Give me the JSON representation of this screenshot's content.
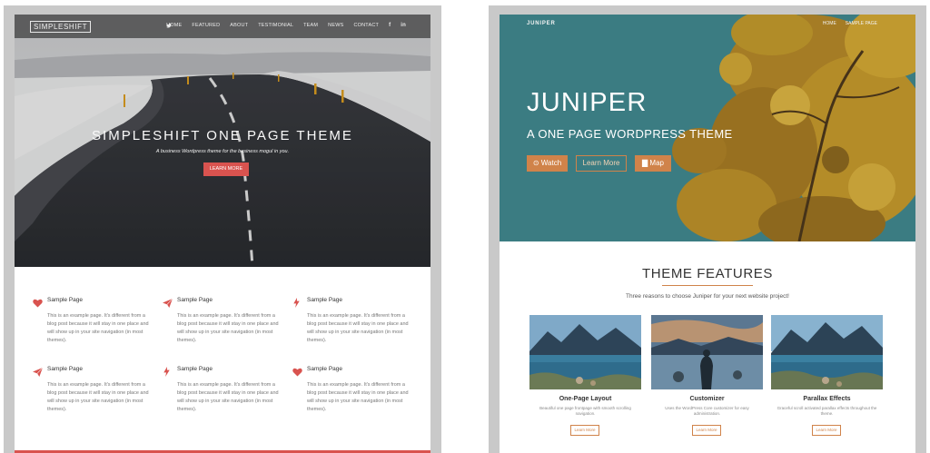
{
  "simpleshift": {
    "logo": "SIMPLESHIFT",
    "nav": [
      "HOME",
      "FEATURED",
      "ABOUT",
      "TESTIMONIAL",
      "TEAM",
      "NEWS",
      "CONTACT"
    ],
    "social": [
      "f",
      "in",
      "t"
    ],
    "hero_title": "SIMPLESHIFT ONE PAGE THEME",
    "hero_subtitle": "A business Wordpress theme for the business mogul in you.",
    "cta_label": "LEARN MORE",
    "features": [
      {
        "icon": "heart-icon",
        "title": "Sample Page",
        "text": "This is an example page. It's different from a blog post because it will stay in one place and will show up in your site navigation (in most themes)."
      },
      {
        "icon": "paper-plane-icon",
        "title": "Sample Page",
        "text": "This is an example page. It's different from a blog post because it will stay in one place and will show up in your site navigation (in most themes)."
      },
      {
        "icon": "lightning-icon",
        "title": "Sample Page",
        "text": "This is an example page. It's different from a blog post because it will stay in one place and will show up in your site navigation (in most themes)."
      },
      {
        "icon": "paper-plane-icon",
        "title": "Sample Page",
        "text": "This is an example page. It's different from a blog post because it will stay in one place and will show up in your site navigation (in most themes)."
      },
      {
        "icon": "lightning-icon",
        "title": "Sample Page",
        "text": "This is an example page. It's different from a blog post because it will stay in one place and will show up in your site navigation (in most themes)."
      },
      {
        "icon": "heart-icon",
        "title": "Sample Page",
        "text": "This is an example page. It's different from a blog post because it will stay in one place and will show up in your site navigation (in most themes)."
      }
    ],
    "accent_color": "#d9534f"
  },
  "juniper": {
    "logo": "JUNIPER",
    "nav": [
      "HOME",
      "SAMPLE PAGE"
    ],
    "hero_title": "JUNIPER",
    "hero_subtitle": "A ONE PAGE WORDPRESS THEME",
    "buttons": {
      "watch": "⊙ Watch",
      "learn": "Learn More",
      "map": "▇ Map"
    },
    "features_title": "THEME FEATURES",
    "features_subtitle": "Three reasons to choose Juniper for your next website project!",
    "cards": [
      {
        "title": "One-Page Layout",
        "text": "Beautiful one page frontpage with smooth scrolling navigation.",
        "button": "Learn More"
      },
      {
        "title": "Customizer",
        "text": "Uses the WordPress Core customizer for easy administration.",
        "button": "Learn More"
      },
      {
        "title": "Parallax Effects",
        "text": "Graceful scroll activated parallax effects throughout the theme.",
        "button": "Learn More"
      }
    ],
    "accent_color": "#d0834a",
    "hero_color": "#3f8288"
  }
}
